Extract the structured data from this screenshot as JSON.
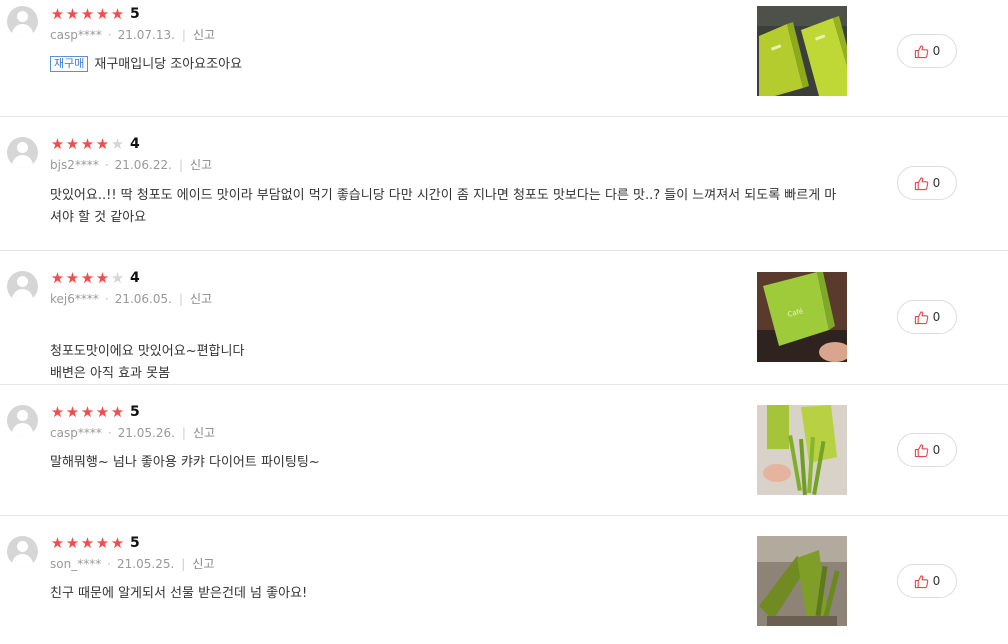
{
  "reviews": [
    {
      "user": "casp****",
      "date": "21.07.13.",
      "report": "신고",
      "rating": 5,
      "score": "5",
      "badge": "재구매",
      "text": "재구매입니당 조아요조아요",
      "likes": "0",
      "photo": "product-box-photo"
    },
    {
      "user": "bjs2****",
      "date": "21.06.22.",
      "report": "신고",
      "rating": 4,
      "score": "4",
      "text": "맛있어요..!! 딱 청포도 에이드 맛이라 부담없이 먹기 좋습니당 다만 시간이 좀 지나면 청포도 맛보다는 다른 맛..? 들이 느껴져서 되도록 빠르게 마셔야 할 것 같아요",
      "likes": "0"
    },
    {
      "user": "kej6****",
      "date": "21.06.05.",
      "report": "신고",
      "rating": 4,
      "score": "4",
      "text": "청포도맛이에요 맛있어요~편합니다\n배변은 아직 효과 못봄",
      "likes": "0",
      "photo": "product-hand-photo"
    },
    {
      "user": "casp****",
      "date": "21.05.26.",
      "report": "신고",
      "rating": 5,
      "score": "5",
      "text": "말해뭐행~ 넘나 좋아용 캬캬 다이어트 파이팅팅~",
      "likes": "0",
      "photo": "product-sticks-photo"
    },
    {
      "user": "son_****",
      "date": "21.05.25.",
      "report": "신고",
      "rating": 5,
      "score": "5",
      "text": "친구 때문에 알게되서 선물 받은건데 넘 좋아요!",
      "likes": "0",
      "photo": "product-sticks-photo"
    }
  ],
  "colors": {
    "star": "#f04e4e",
    "star_off": "#d6d6d6",
    "badge": "#3d7bd0",
    "like_icon": "#e8474c"
  }
}
